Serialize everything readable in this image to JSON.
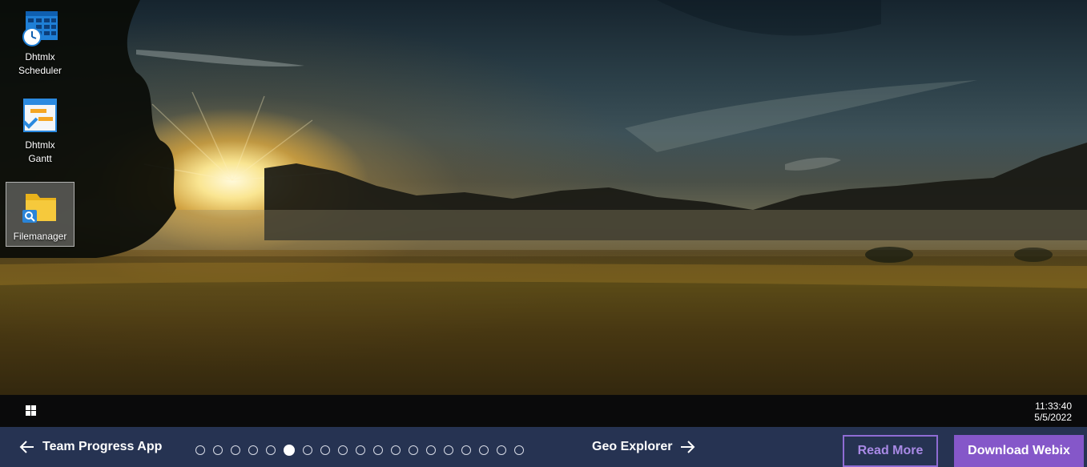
{
  "desktop": {
    "icons": [
      {
        "label_line1": "Dhtmlx",
        "label_line2": "Scheduler",
        "icon": "scheduler-calendar-clock-icon",
        "selected": false
      },
      {
        "label_line1": "Dhtmlx",
        "label_line2": "Gantt",
        "icon": "gantt-chart-icon",
        "selected": false
      },
      {
        "label_line1": "Filemanager",
        "label_line2": "",
        "icon": "folder-search-icon",
        "selected": true
      }
    ]
  },
  "taskbar": {
    "start_icon": "windows-start-icon",
    "time": "11:33:40",
    "date": "5/5/2022"
  },
  "navbar": {
    "prev_label": "Team Progress App",
    "next_label": "Geo Explorer",
    "dots_total": 19,
    "dots_active_index": 5,
    "read_more_label": "Read More",
    "download_label": "Download Webix",
    "colors": {
      "bar": "#263352",
      "accent": "#8557c9",
      "accent_outline": "#8f6cd4"
    }
  }
}
